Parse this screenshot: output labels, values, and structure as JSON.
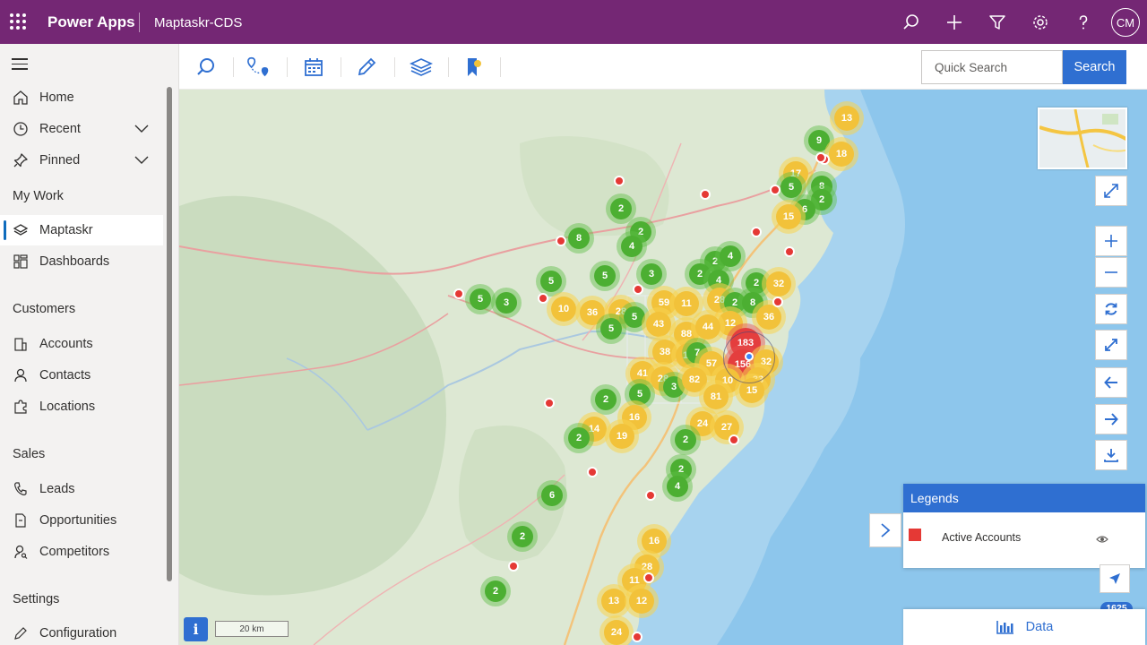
{
  "topbar": {
    "app_name": "Power Apps",
    "environment": "Maptaskr-CDS",
    "avatar_initials": "CM",
    "icons": [
      "search-icon",
      "add-icon",
      "filter-icon",
      "settings-icon",
      "help-icon"
    ]
  },
  "sidebar": {
    "top_items": [
      {
        "label": "Home",
        "icon": "home-icon"
      },
      {
        "label": "Recent",
        "icon": "clock-icon"
      },
      {
        "label": "Pinned",
        "icon": "pin-icon"
      }
    ],
    "sections": [
      {
        "title": "My Work",
        "items": [
          {
            "label": "Maptaskr",
            "icon": "layers-icon",
            "selected": true
          },
          {
            "label": "Dashboards",
            "icon": "dashboard-icon"
          }
        ]
      },
      {
        "title": "Customers",
        "items": [
          {
            "label": "Accounts",
            "icon": "building-icon"
          },
          {
            "label": "Contacts",
            "icon": "person-icon"
          },
          {
            "label": "Locations",
            "icon": "puzzle-icon"
          }
        ]
      },
      {
        "title": "Sales",
        "items": [
          {
            "label": "Leads",
            "icon": "phone-icon"
          },
          {
            "label": "Opportunities",
            "icon": "document-icon"
          },
          {
            "label": "Competitors",
            "icon": "person-search-icon"
          }
        ]
      },
      {
        "title": "Settings",
        "items": [
          {
            "label": "Configuration",
            "icon": "pencil-icon"
          }
        ]
      }
    ]
  },
  "toolbar": {
    "search_placeholder": "Quick Search",
    "search_button": "Search",
    "tools": [
      "search-tool-icon",
      "route-tool-icon",
      "calendar-tool-icon",
      "draw-tool-icon",
      "layers-tool-icon",
      "bookmark-tool-icon"
    ]
  },
  "map": {
    "legend_title": "Legends",
    "legend_item": "Active Accounts",
    "legend_color": "#e53935",
    "data_button": "Data",
    "record_count": "1625",
    "scale_label": "20 km",
    "info_label": "i",
    "clusters": [
      {
        "n": "13",
        "c": "y"
      },
      {
        "n": "9",
        "c": "g"
      },
      {
        "n": "18",
        "c": "y"
      },
      {
        "n": "17",
        "c": "y"
      },
      {
        "n": "5",
        "c": "g"
      },
      {
        "n": "8",
        "c": "g"
      },
      {
        "n": "2",
        "c": "g"
      },
      {
        "n": "6",
        "c": "g"
      },
      {
        "n": "15",
        "c": "y"
      },
      {
        "n": "2",
        "c": "g"
      },
      {
        "n": "2",
        "c": "g"
      },
      {
        "n": "8",
        "c": "g"
      },
      {
        "n": "4",
        "c": "g"
      },
      {
        "n": "2",
        "c": "g"
      },
      {
        "n": "4",
        "c": "g"
      },
      {
        "n": "3",
        "c": "g"
      },
      {
        "n": "5",
        "c": "g"
      },
      {
        "n": "5",
        "c": "g"
      },
      {
        "n": "3",
        "c": "g"
      },
      {
        "n": "5",
        "c": "g"
      },
      {
        "n": "10",
        "c": "y"
      },
      {
        "n": "36",
        "c": "y"
      },
      {
        "n": "28",
        "c": "y"
      },
      {
        "n": "5",
        "c": "g"
      },
      {
        "n": "59",
        "c": "y"
      },
      {
        "n": "11",
        "c": "y"
      },
      {
        "n": "2",
        "c": "g"
      },
      {
        "n": "4",
        "c": "g"
      },
      {
        "n": "2",
        "c": "g"
      },
      {
        "n": "32",
        "c": "y"
      },
      {
        "n": "28",
        "c": "y"
      },
      {
        "n": "2",
        "c": "g"
      },
      {
        "n": "8",
        "c": "g"
      },
      {
        "n": "5",
        "c": "g"
      },
      {
        "n": "43",
        "c": "y"
      },
      {
        "n": "12",
        "c": "y"
      },
      {
        "n": "36",
        "c": "y"
      },
      {
        "n": "88",
        "c": "y"
      },
      {
        "n": "44",
        "c": "y"
      },
      {
        "n": "183",
        "c": "r"
      },
      {
        "n": "38",
        "c": "y"
      },
      {
        "n": "15",
        "c": "y"
      },
      {
        "n": "7",
        "c": "g"
      },
      {
        "n": "57",
        "c": "y"
      },
      {
        "n": "156",
        "c": "r"
      },
      {
        "n": "32",
        "c": "y"
      },
      {
        "n": "41",
        "c": "y"
      },
      {
        "n": "28",
        "c": "y"
      },
      {
        "n": "3",
        "c": "g"
      },
      {
        "n": "82",
        "c": "y"
      },
      {
        "n": "10",
        "c": "y"
      },
      {
        "n": "33",
        "c": "y"
      },
      {
        "n": "15",
        "c": "y"
      },
      {
        "n": "2",
        "c": "g"
      },
      {
        "n": "5",
        "c": "g"
      },
      {
        "n": "81",
        "c": "y"
      },
      {
        "n": "16",
        "c": "y"
      },
      {
        "n": "14",
        "c": "y"
      },
      {
        "n": "24",
        "c": "y"
      },
      {
        "n": "27",
        "c": "y"
      },
      {
        "n": "2",
        "c": "g"
      },
      {
        "n": "19",
        "c": "y"
      },
      {
        "n": "2",
        "c": "g"
      },
      {
        "n": "2",
        "c": "g"
      },
      {
        "n": "4",
        "c": "g"
      },
      {
        "n": "6",
        "c": "g"
      },
      {
        "n": "2",
        "c": "g"
      },
      {
        "n": "16",
        "c": "y"
      },
      {
        "n": "28",
        "c": "y"
      },
      {
        "n": "11",
        "c": "y"
      },
      {
        "n": "2",
        "c": "g"
      },
      {
        "n": "13",
        "c": "y"
      },
      {
        "n": "12",
        "c": "y"
      },
      {
        "n": "24",
        "c": "y"
      }
    ]
  }
}
